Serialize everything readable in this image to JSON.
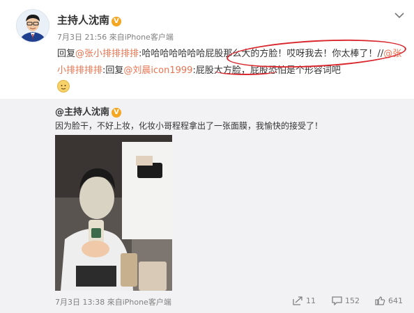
{
  "post": {
    "user_name": "主持人沈南",
    "verified_badge": "V",
    "meta": "7月3日 21:56 來自iPhone客户端",
    "reply": {
      "prefix": "回复",
      "mention1": "@张小排排排排",
      "part1": ":哈哈哈哈哈哈哈",
      "highlight": "屁股那么大的方脸！哎呀我去！你太棒了！",
      "separator": "//",
      "mention2": "@张小排排排排",
      "part2": ":回复",
      "mention3": "@刘晨icon1999",
      "part3": ":屁股大方脸，屁股恐怕是个形容词吧"
    },
    "emoji": "doge-emoji"
  },
  "original": {
    "author": "@主持人沈南",
    "verified_badge": "V",
    "text": "因为脸干，不好上妆，化妆小哥程程拿出了一张面膜，我愉快的接受了！",
    "meta": "7月3日 13:38 來自iPhone客户端",
    "repost_count": "11",
    "comment_count": "152",
    "like_count": "641"
  },
  "icons": {
    "more": "chevron-down-icon",
    "repost": "repost-icon",
    "comment": "comment-icon",
    "like": "thumbs-up-icon"
  },
  "colors": {
    "link": "#eb7350",
    "annotation": "#d9262c",
    "badge": "#f5a623",
    "original_bg": "#f2f2f5"
  }
}
